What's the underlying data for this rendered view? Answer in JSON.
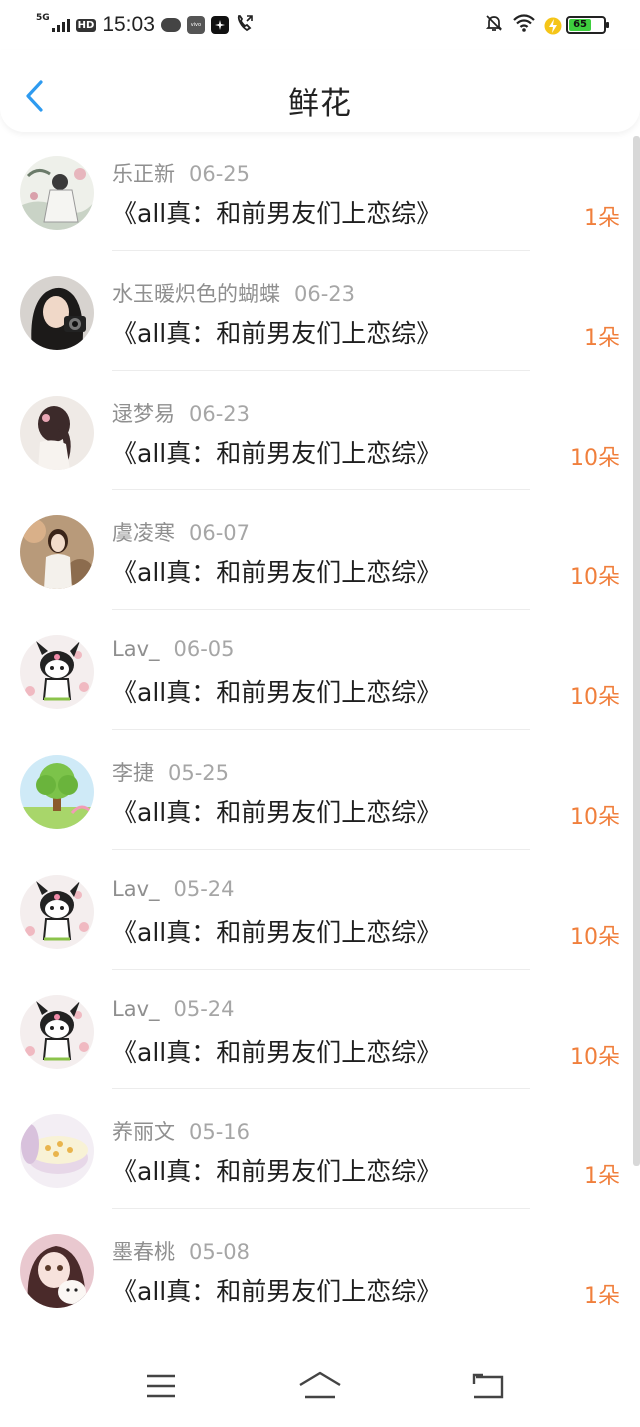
{
  "status_bar": {
    "network": "5G",
    "hd": "HD",
    "time": "15:03",
    "vivo_label": "vivo",
    "battery_level": "65",
    "battery_fraction": 0.65
  },
  "header": {
    "title": "鲜花",
    "back_icon": "chevron-left-icon"
  },
  "colors": {
    "accent_blue": "#2e9bf0",
    "count_orange": "#f07f3c",
    "meta_gray": "#8f8f8f",
    "title_dark": "#1e1e1e"
  },
  "list": {
    "items": [
      {
        "user": "乐正新",
        "date": "06-25",
        "title": "《all真：和前男友们上恋综》",
        "count": "1朵",
        "avatar": "ink-painting-avatar"
      },
      {
        "user": "水玉暖炽色的蝴蝶",
        "date": "06-23",
        "title": "《all真：和前男友们上恋综》",
        "count": "1朵",
        "avatar": "girl-camera-avatar"
      },
      {
        "user": "逯梦易",
        "date": "06-23",
        "title": "《all真：和前男友们上恋综》",
        "count": "10朵",
        "avatar": "ponytail-girl-avatar"
      },
      {
        "user": "虞凌寒",
        "date": "06-07",
        "title": "《all真：和前男友们上恋综》",
        "count": "10朵",
        "avatar": "girl-autumn-avatar"
      },
      {
        "user": "Lav_",
        "date": "06-05",
        "title": "《all真：和前男友们上恋综》",
        "count": "10朵",
        "avatar": "kuromi-avatar"
      },
      {
        "user": "李捷",
        "date": "05-25",
        "title": "《all真：和前男友们上恋综》",
        "count": "10朵",
        "avatar": "tree-avatar"
      },
      {
        "user": "Lav_",
        "date": "05-24",
        "title": "《all真：和前男友们上恋综》",
        "count": "10朵",
        "avatar": "kuromi-avatar"
      },
      {
        "user": "Lav_",
        "date": "05-24",
        "title": "《all真：和前男友们上恋综》",
        "count": "10朵",
        "avatar": "kuromi-avatar"
      },
      {
        "user": "养丽文",
        "date": "05-16",
        "title": "《all真：和前男友们上恋综》",
        "count": "1朵",
        "avatar": "cake-avatar"
      },
      {
        "user": "墨春桃",
        "date": "05-08",
        "title": "《all真：和前男友们上恋综》",
        "count": "1朵",
        "avatar": "doll-puppy-avatar"
      }
    ]
  },
  "nav_bar": {
    "menu_icon": "menu-icon",
    "home_icon": "home-icon",
    "back_icon": "back-icon"
  }
}
